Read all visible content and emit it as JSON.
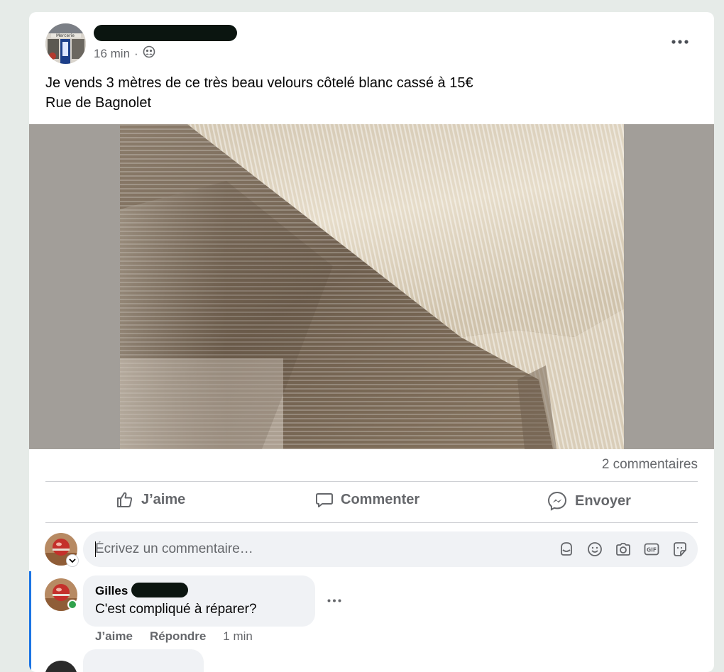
{
  "post": {
    "time": "16 min",
    "separator": "·",
    "text_line1": "Je vends 3 mètres de ce très beau velours côtelé blanc cassé à 15€",
    "text_line2": "Rue de Bagnolet",
    "page_sign_text": "Mercerie",
    "comments_count": "2 commentaires"
  },
  "actions": {
    "like": "J’aime",
    "comment": "Commenter",
    "send": "Envoyer"
  },
  "composer": {
    "placeholder": "Écrivez un commentaire…",
    "value": ""
  },
  "comment": {
    "author": "Gilles",
    "text": "C'est compliqué à réparer?",
    "like": "J’aime",
    "reply": "Répondre",
    "time": "1 min"
  },
  "colors": {
    "background": "#e6ebe8",
    "card": "#ffffff",
    "secondary_text": "#65676b",
    "accent_blue": "#1b74e4",
    "online_green": "#31a24c",
    "bubble": "#f0f2f5"
  },
  "icons": {
    "audience": "friends-icon",
    "menu": "more-dots-icon",
    "like": "thumbs-up-icon",
    "comment": "speech-bubble-icon",
    "send": "messenger-icon",
    "composer_tools": [
      "avatar-sticker-icon",
      "emoji-icon",
      "camera-icon",
      "gif-icon",
      "sticker-icon"
    ]
  }
}
